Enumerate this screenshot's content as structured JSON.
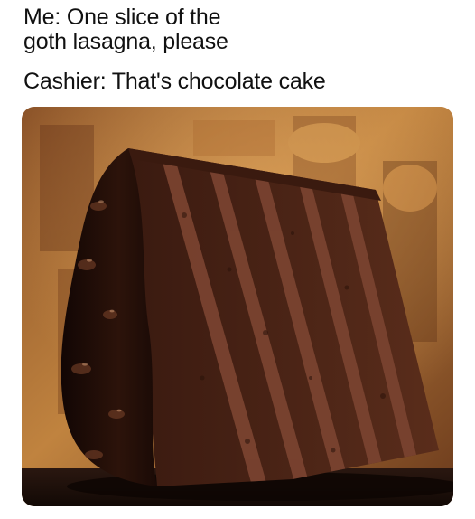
{
  "caption": {
    "me_line": "Me: One slice of the\ngoth lasagna, please",
    "cashier_line": "Cashier: That's chocolate cake"
  },
  "photo": {
    "subject": "slice of multi-layer chocolate cake with glossy fudge frosting",
    "background": "blurred warm ornate painted interior"
  },
  "colors": {
    "frosting": "#2a130b",
    "cake_crumb": "#4a2416",
    "filling": "#6e3a26",
    "background_warm": "#b0703c",
    "table": "#1b0f0b"
  }
}
